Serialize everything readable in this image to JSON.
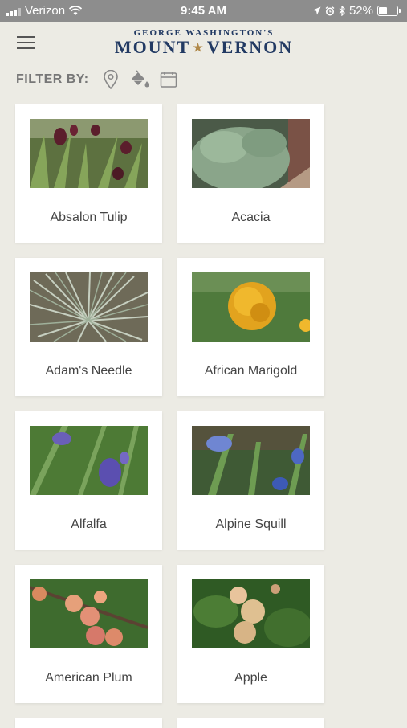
{
  "status": {
    "carrier": "Verizon",
    "time": "9:45 AM",
    "battery": "52%",
    "battery_level": 0.52
  },
  "header": {
    "logo_top": "GEORGE WASHINGTON'S",
    "logo_left": "MOUNT",
    "logo_right": "VERNON"
  },
  "filter": {
    "label": "FILTER BY:",
    "icons": [
      "location-pin-icon",
      "paint-bucket-icon",
      "calendar-icon"
    ]
  },
  "plants": [
    {
      "name": "Absalon Tulip"
    },
    {
      "name": "Acacia"
    },
    {
      "name": "Adam's Needle"
    },
    {
      "name": "African Marigold"
    },
    {
      "name": "Alfalfa"
    },
    {
      "name": "Alpine Squill"
    },
    {
      "name": "American Plum"
    },
    {
      "name": "Apple"
    }
  ]
}
